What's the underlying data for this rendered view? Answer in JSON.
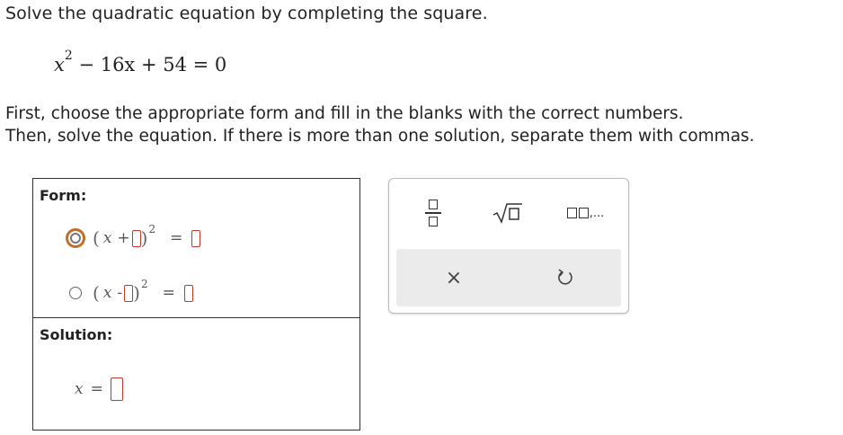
{
  "question": {
    "prompt": "Solve the quadratic equation by completing the square.",
    "equation": {
      "variable": "x",
      "exponent": "2",
      "rest": " − 16x + 54 = 0"
    },
    "instructions_line1": "First, choose the appropriate form and fill in the blanks with the correct numbers.",
    "instructions_line2": "Then, solve the equation. If there is more than one solution, separate them with commas."
  },
  "form_box": {
    "title": "Form:",
    "options": [
      {
        "variable": "x",
        "operator": "+",
        "exponent": "2",
        "equals": "="
      },
      {
        "variable": "x",
        "operator": "-",
        "exponent": "2",
        "equals": "="
      }
    ]
  },
  "solution_box": {
    "title": "Solution:",
    "variable": "x",
    "equals": "="
  },
  "toolbox": {
    "list_suffix": ",...",
    "clear_symbol": "×"
  },
  "colors": {
    "blank_border": "#c0392b",
    "radio_hover": "#c0702a",
    "action_bar": "#ebebeb"
  },
  "icons": [
    "fraction-icon",
    "square-root-icon",
    "list-icon",
    "clear-icon",
    "undo-icon"
  ]
}
